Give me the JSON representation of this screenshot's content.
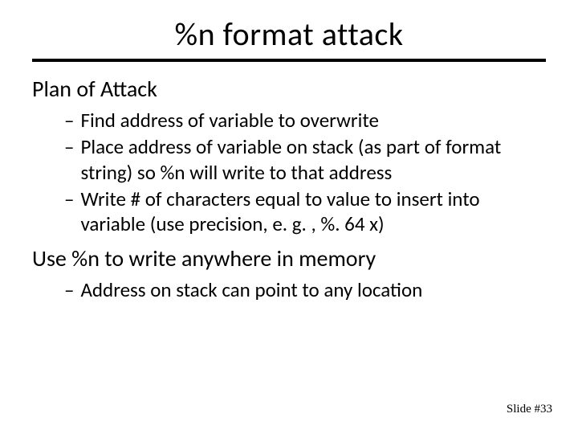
{
  "title": "%n format attack",
  "section1": "Plan of Attack",
  "bullets1": [
    "Find address of variable to overwrite",
    "Place address of variable on stack (as part of format string) so %n will write to that address",
    "Write # of characters equal to value to insert into variable (use precision, e. g. , %. 64 x)"
  ],
  "section2": "Use %n to write anywhere in memory",
  "bullets2": [
    "Address on stack can point to any location"
  ],
  "footer": "Slide #33"
}
